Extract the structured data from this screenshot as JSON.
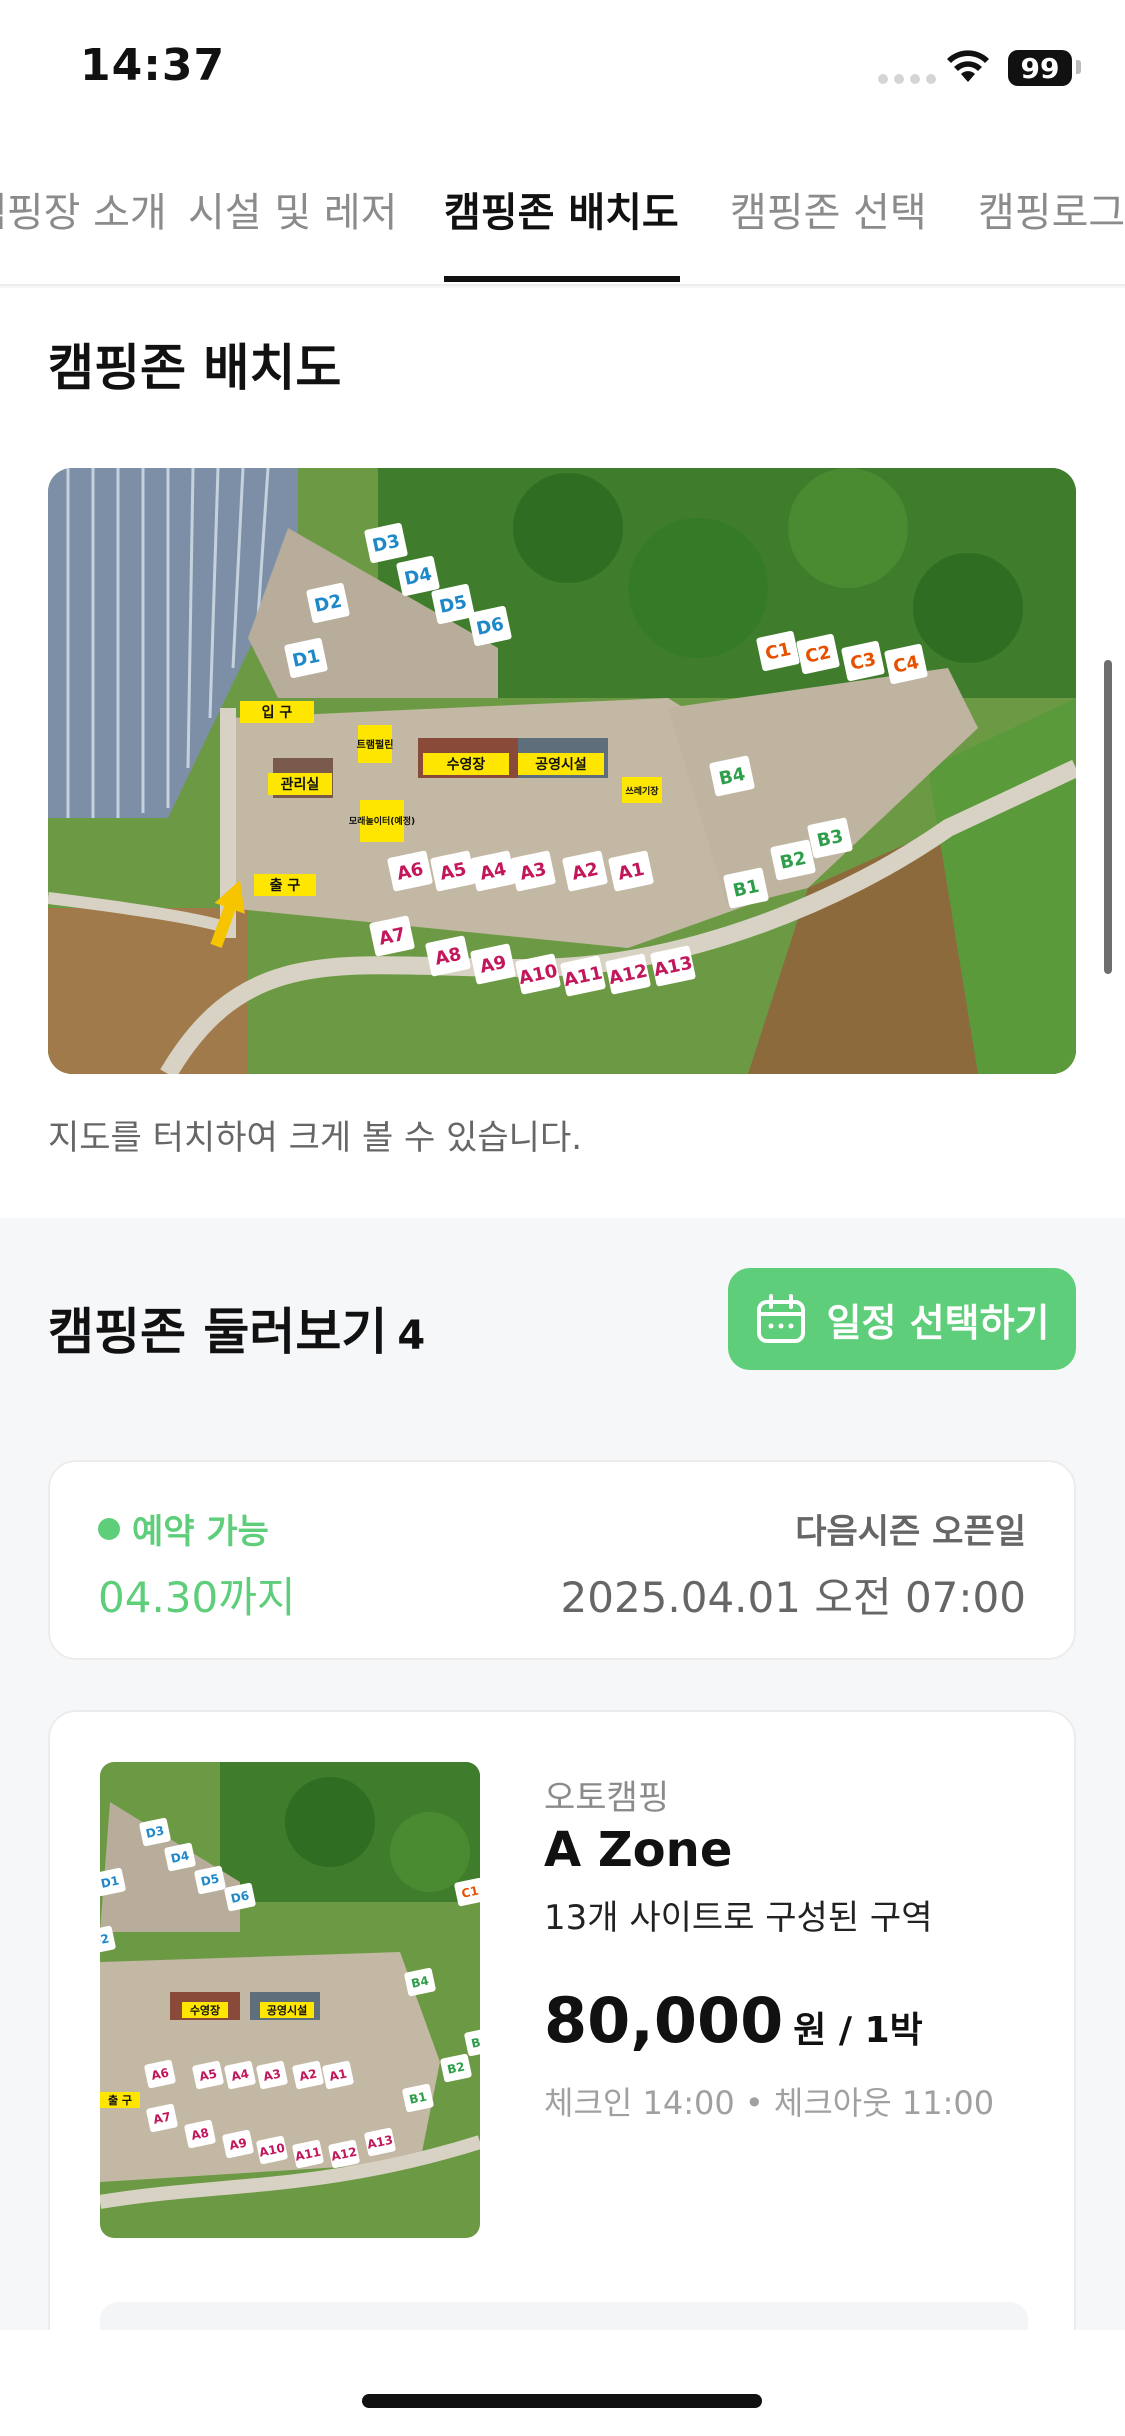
{
  "status_bar": {
    "time": "14:37",
    "battery": "99"
  },
  "tabs": [
    {
      "label": "캠핑장 소개"
    },
    {
      "label": "시설 및 레저"
    },
    {
      "label": "캠핑존 배치도",
      "active": true
    },
    {
      "label": "캠핑존 선택"
    },
    {
      "label": "캠핑로그"
    }
  ],
  "map_section": {
    "title": "캠핑존 배치도",
    "hint": "지도를 터치하여 크게 볼 수 있습니다.",
    "map_labels": {
      "entrance": "입 구",
      "exit": "출 구",
      "office": "관리실",
      "trampoline": "트램펄린",
      "pool": "수영장",
      "public_facility": "공영시설",
      "sand_playground": "모래놀이터(예정)",
      "trash": "쓰레기장"
    },
    "sites_a": [
      "A1",
      "A2",
      "A3",
      "A4",
      "A5",
      "A6",
      "A7",
      "A8",
      "A9",
      "A10",
      "A11",
      "A12",
      "A13"
    ],
    "sites_b": [
      "B1",
      "B2",
      "B3",
      "B4"
    ],
    "sites_c": [
      "C1",
      "C2",
      "C3",
      "C4"
    ],
    "sites_d": [
      "D1",
      "D2",
      "D3",
      "D4",
      "D5",
      "D6"
    ]
  },
  "browse": {
    "title": "캠핑존 둘러보기",
    "count": "4",
    "schedule_button": "일정 선택하기"
  },
  "availability": {
    "status": "예약 가능",
    "until": "04.30까지",
    "next_open_label": "다음시즌 오픈일",
    "next_open_date": "2025.04.01 오전 07:00"
  },
  "zone": {
    "type": "오토캠핑",
    "name": "A Zone",
    "desc": "13개 사이트로 구성된 구역",
    "price": "80,000",
    "price_unit": "원 / 1박",
    "checkin": "체크인 14:00 • 체크아웃 11:00"
  },
  "colors": {
    "accent_green": "#5ece7a",
    "site_a": "#c2185b",
    "site_b": "#2e9e4a",
    "site_c": "#e65100",
    "site_d": "#1e88c9",
    "label_yellow": "#ffe600"
  }
}
